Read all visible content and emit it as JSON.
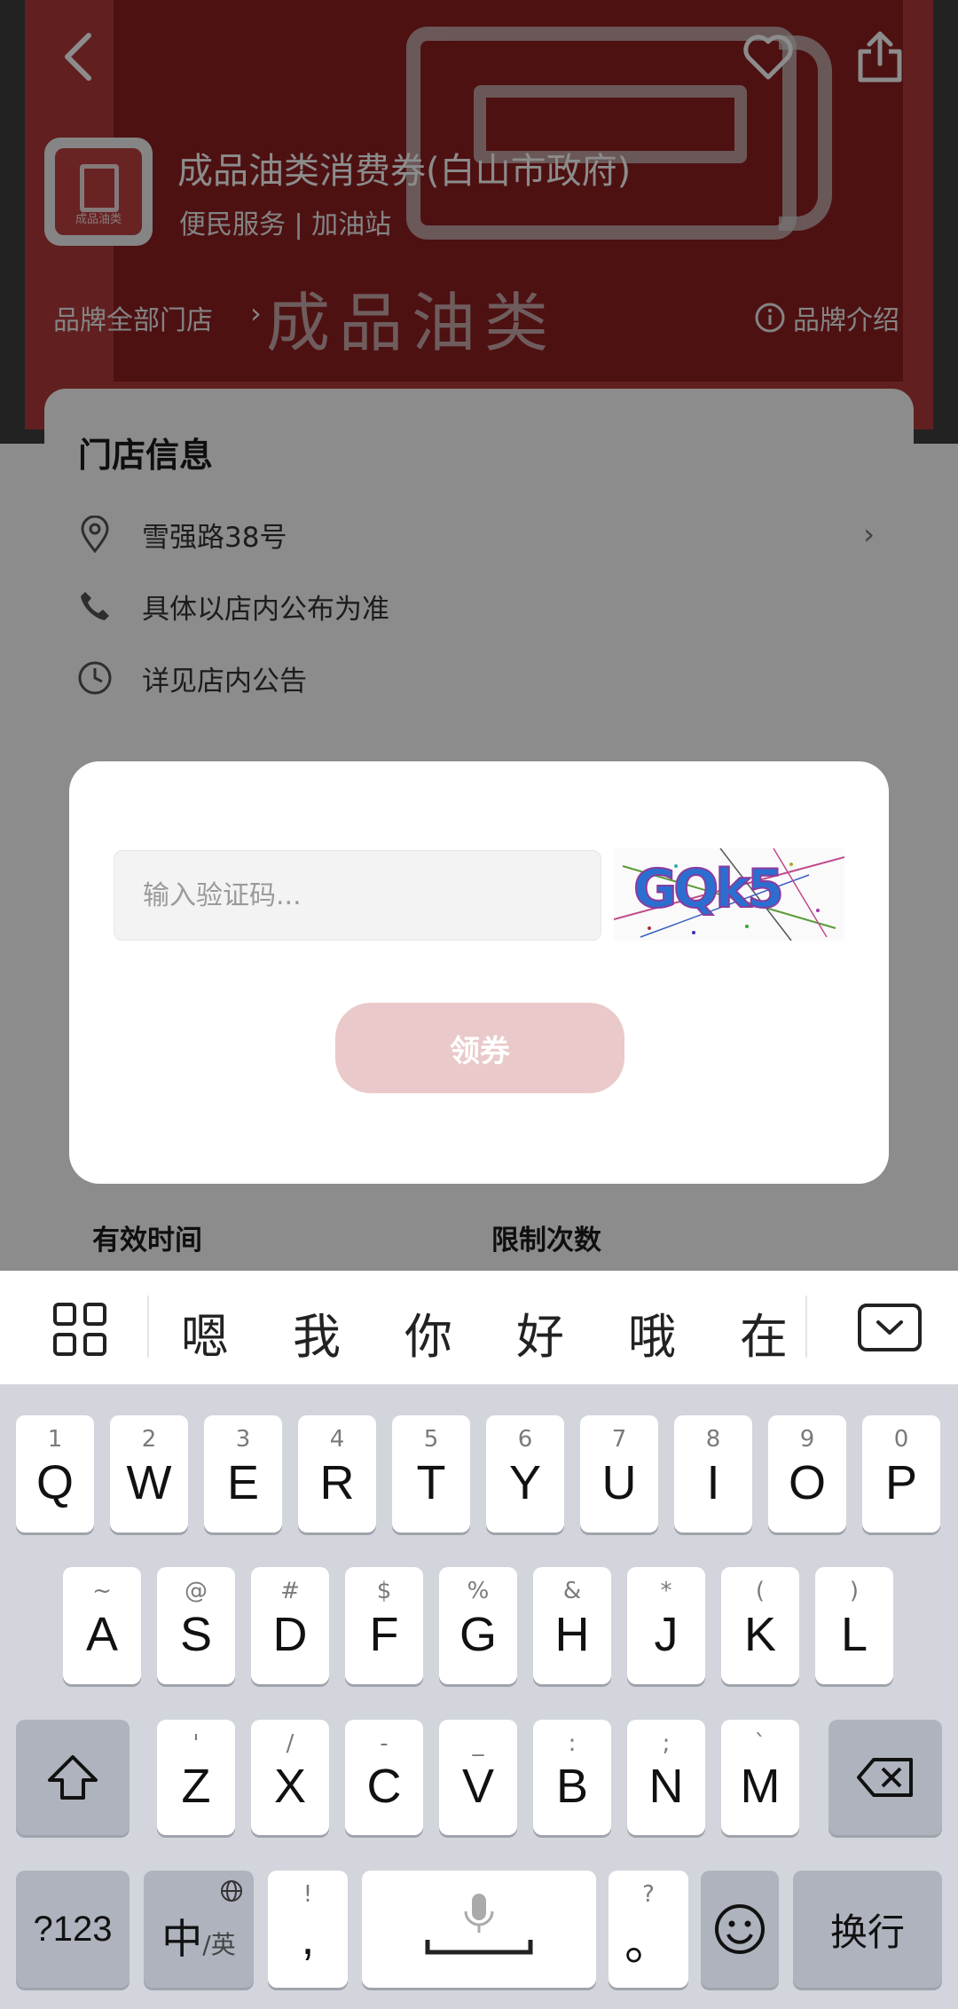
{
  "brand": {
    "title": "成品油类消费券(白山市政府)",
    "subtitle": "便民服务 | 加油站",
    "all_stores_label": "品牌全部门店",
    "intro_label": "品牌介绍",
    "banner_text": "成品油类"
  },
  "store": {
    "title": "门店信息",
    "address": "雪强路38号",
    "phone": "具体以店内公布为准",
    "hours": "详见店内公告"
  },
  "details": {
    "valid_time_label": "有效时间",
    "limit_label": "限制次数"
  },
  "captcha_modal": {
    "placeholder": "输入验证码...",
    "captcha_text": "GQk5",
    "claim_button": "领券"
  },
  "ime": {
    "candidates": [
      "嗯",
      "我",
      "你",
      "好",
      "哦",
      "在"
    ]
  },
  "keyboard": {
    "row1": [
      {
        "hint": "1",
        "key": "Q"
      },
      {
        "hint": "2",
        "key": "W"
      },
      {
        "hint": "3",
        "key": "E"
      },
      {
        "hint": "4",
        "key": "R"
      },
      {
        "hint": "5",
        "key": "T"
      },
      {
        "hint": "6",
        "key": "Y"
      },
      {
        "hint": "7",
        "key": "U"
      },
      {
        "hint": "8",
        "key": "I"
      },
      {
        "hint": "9",
        "key": "O"
      },
      {
        "hint": "0",
        "key": "P"
      }
    ],
    "row2": [
      {
        "hint": "~",
        "key": "A"
      },
      {
        "hint": "@",
        "key": "S"
      },
      {
        "hint": "#",
        "key": "D"
      },
      {
        "hint": "$",
        "key": "F"
      },
      {
        "hint": "%",
        "key": "G"
      },
      {
        "hint": "&",
        "key": "H"
      },
      {
        "hint": "*",
        "key": "J"
      },
      {
        "hint": "(",
        "key": "K"
      },
      {
        "hint": ")",
        "key": "L"
      }
    ],
    "row3": [
      {
        "hint": "'",
        "key": "Z"
      },
      {
        "hint": "/",
        "key": "X"
      },
      {
        "hint": "-",
        "key": "C"
      },
      {
        "hint": "_",
        "key": "V"
      },
      {
        "hint": ":",
        "key": "B"
      },
      {
        "hint": ";",
        "key": "N"
      },
      {
        "hint": "`",
        "key": "M"
      }
    ],
    "numbers_key": "?123",
    "lang_key_main": "中",
    "lang_key_sub": "/英",
    "comma_hint": "!",
    "comma_key": ",",
    "period_hint": "?",
    "period_key": "。",
    "enter_key": "换行"
  },
  "colors": {
    "accent": "#e9c9c9",
    "keyboard_bg": "#d2d5dc"
  }
}
